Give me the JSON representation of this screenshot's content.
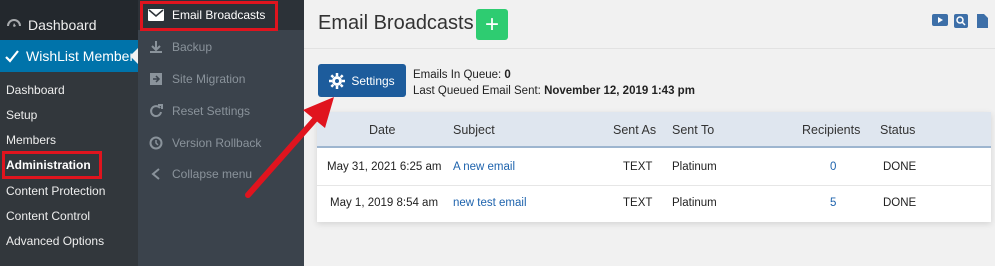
{
  "wp_menu": {
    "dashboard": "Dashboard",
    "wishlist": "WishList Member",
    "submenu": [
      "Dashboard",
      "Setup",
      "Members",
      "Administration",
      "Content Protection",
      "Content Control",
      "Advanced Options"
    ]
  },
  "wl_menu": {
    "items": [
      {
        "label": "Email Broadcasts",
        "icon": "envelope-icon"
      },
      {
        "label": "Backup",
        "icon": "download-icon"
      },
      {
        "label": "Site Migration",
        "icon": "migration-icon"
      },
      {
        "label": "Reset Settings",
        "icon": "reset-icon"
      },
      {
        "label": "Version Rollback",
        "icon": "rollback-icon"
      },
      {
        "label": "Collapse menu",
        "icon": "collapse-icon"
      }
    ]
  },
  "main": {
    "title": "Email Broadcasts",
    "add_label": "+",
    "settings_label": "Settings",
    "queue_label": "Emails In Queue:",
    "queue_value": "0",
    "last_label": "Last Queued Email Sent:",
    "last_value": "November 12, 2019 1:43 pm"
  },
  "table": {
    "headers": [
      "Date",
      "Subject",
      "Sent As",
      "Sent To",
      "Recipients",
      "Status"
    ],
    "rows": [
      [
        "May 31, 2021 6:25 am",
        "A new email",
        "TEXT",
        "Platinum",
        "0",
        "DONE"
      ],
      [
        "May 1, 2019 8:54 am",
        "new test email",
        "TEXT",
        "Platinum",
        "5",
        "DONE"
      ]
    ]
  },
  "colors": {
    "highlight": "#e0141e",
    "accent": "#1d5c9c",
    "add": "#2ecc71"
  }
}
